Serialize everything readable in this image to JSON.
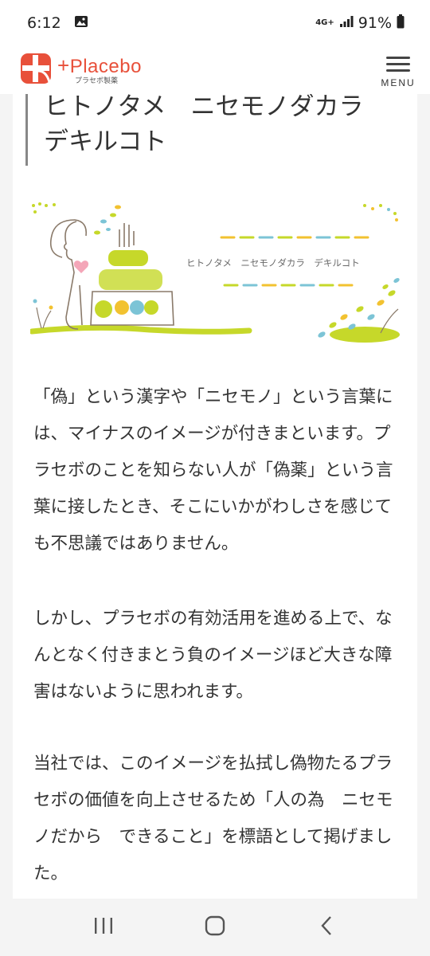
{
  "status_bar": {
    "time": "6:12",
    "network": "4G+",
    "battery": "91%"
  },
  "header": {
    "logo_name": "Placebo",
    "logo_sub": "プラセボ製薬",
    "menu_label": "MENU",
    "brand_color": "#e8503a"
  },
  "article": {
    "heading_line1": "ヒトノタメ　ニセモノダカラ",
    "heading_line2": "デキルコト",
    "hero_caption": "ヒトノタメ　ニセモノダカラ　デキルコト",
    "paragraph1": "「偽」という漢字や「ニセモノ」という言葉には、マイナスのイメージが付きまといます。プラセボのことを知らない人が「偽薬」という言葉に接したとき、そこにいかがわしさを感じても不思議ではありません。",
    "paragraph2": "しかし、プラセボの有効活用を進める上で、なんとなく付きまとう負のイメージほど大きな障害はないように思われます。",
    "paragraph3": "当社では、このイメージを払拭し偽物たるプラセボの価値を向上させるため「人の為　ニセモノだから　できること」を標語として掲げました。"
  },
  "colors": {
    "leaf_green": "#c6d82a",
    "leaf_blue": "#7cc4d6",
    "leaf_yellow": "#f2c230",
    "heart_pink": "#f4a6b8"
  }
}
